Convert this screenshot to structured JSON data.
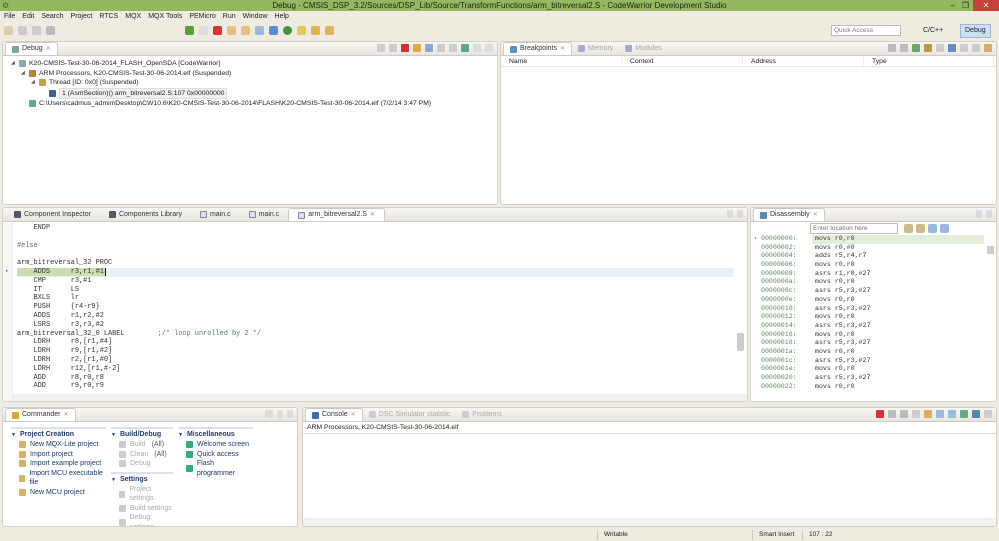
{
  "window": {
    "title": "Debug - CMSIS_DSP_3.2/Sources/DSP_Lib/Source/TransformFunctions/arm_bitreversal2.S - CodeWarrior Development Studio",
    "controls": [
      "–",
      "❐",
      "✕"
    ]
  },
  "menu": [
    "File",
    "Edit",
    "Search",
    "Project",
    "RTCS",
    "MQX",
    "MQX Tools",
    "PEMicro",
    "Run",
    "Window",
    "Help"
  ],
  "toolbar": {
    "quick_access_placeholder": "Quick Access",
    "perspectives": [
      {
        "label": "C/C++",
        "active": false
      },
      {
        "label": "Debug",
        "active": true
      }
    ]
  },
  "debug_view": {
    "tab": "Debug",
    "tree": [
      {
        "level": 0,
        "label": "K20-CMSIS-Test-30-06-2014_FLASH_OpenSDA [CodeWarrior]",
        "icon": "launch-icon"
      },
      {
        "level": 1,
        "label": "ARM Processors, K20-CMSIS-Test-30-06-2014.elf (Suspended)",
        "icon": "processor-icon"
      },
      {
        "level": 2,
        "label": "Thread [ID: 0x0] (Suspended)",
        "icon": "thread-icon"
      },
      {
        "level": 3,
        "label": "1 (AsmSection)() arm_bitreversal2.S:107 0x00000000",
        "icon": "stack-frame-icon",
        "selected": true
      },
      {
        "level": 1,
        "label": "C:\\Users\\cadmus_admin\\Desktop\\CW10.6\\K20-CMSIS-Test-30-06-2014\\FLASH\\K20-CMSIS-Test-30-06-2014.elf (7/2/14 3:47 PM)",
        "icon": "binary-icon"
      }
    ]
  },
  "breakpoints_view": {
    "tabs": [
      {
        "label": "Breakpoints",
        "active": true
      },
      {
        "label": "Memory",
        "active": false
      },
      {
        "label": "Modules",
        "active": false
      }
    ],
    "columns": [
      "Name",
      "Context",
      "Address",
      "Type"
    ]
  },
  "editor": {
    "tabs": [
      {
        "label": "Component Inspector"
      },
      {
        "label": "Components Library"
      },
      {
        "label": "main.c"
      },
      {
        "label": "main.c"
      },
      {
        "label": "arm_bitreversal2.S",
        "active": true
      }
    ],
    "current_line_index": 4,
    "lines": [
      {
        "text": "    ENDP"
      },
      {
        "text": ""
      },
      {
        "text": "#else"
      },
      {
        "text": ""
      },
      {
        "text": "arm_bitreversal_32 PROC"
      },
      {
        "text": "    ADDS     r3,r1,#1"
      },
      {
        "text": "    CMP      r3,#1"
      },
      {
        "text": "    IT       LS"
      },
      {
        "text": "    BXLS     lr"
      },
      {
        "text": "    PUSH     {r4-r9}"
      },
      {
        "text": "    ADDS     r1,r2,#2"
      },
      {
        "text": "    LSRS     r3,r3,#2"
      },
      {
        "text": "arm_bitreversal_32_0 LABEL        ;/* loop unrolled by 2 */"
      },
      {
        "text": "    LDRH     r8,[r1,#4]"
      },
      {
        "text": "    LDRH     r9,[r1,#2]"
      },
      {
        "text": "    LDRH     r2,[r1,#0]"
      },
      {
        "text": "    LDRH     r12,[r1,#-2]"
      },
      {
        "text": "    ADD      r8,r0,r8"
      },
      {
        "text": "    ADD      r9,r0,r9"
      }
    ]
  },
  "disassembly": {
    "tab": "Disassembly",
    "location_placeholder": "Enter location here",
    "rows": [
      {
        "addr": "00000000:",
        "instr": "movs r0,r0"
      },
      {
        "addr": "00000002:",
        "instr": "movs r0,#0"
      },
      {
        "addr": "00000004:",
        "instr": "adds r5,r4,r7"
      },
      {
        "addr": "00000006:",
        "instr": "movs r0,r0"
      },
      {
        "addr": "00000008:",
        "instr": "asrs r1,r0,#27"
      },
      {
        "addr": "0000000a:",
        "instr": "movs r0,r0"
      },
      {
        "addr": "0000000c:",
        "instr": "asrs r5,r3,#27"
      },
      {
        "addr": "0000000e:",
        "instr": "movs r0,r0"
      },
      {
        "addr": "00000010:",
        "instr": "asrs r5,r3,#27"
      },
      {
        "addr": "00000012:",
        "instr": "movs r0,r0"
      },
      {
        "addr": "00000014:",
        "instr": "asrs r5,r3,#27"
      },
      {
        "addr": "00000016:",
        "instr": "movs r0,r0"
      },
      {
        "addr": "00000018:",
        "instr": "asrs r5,r3,#27"
      },
      {
        "addr": "0000001a:",
        "instr": "movs r0,r0"
      },
      {
        "addr": "0000001c:",
        "instr": "asrs r5,r3,#27"
      },
      {
        "addr": "0000001e:",
        "instr": "movs r0,r0"
      },
      {
        "addr": "00000020:",
        "instr": "asrs r5,r3,#27"
      },
      {
        "addr": "00000022:",
        "instr": "movs r0,r0"
      }
    ]
  },
  "commander": {
    "tab": "Commander",
    "sections": [
      {
        "title": "Project Creation",
        "items": [
          {
            "label": "New MQX-Lite project"
          },
          {
            "label": "Import project"
          },
          {
            "label": "Import example project"
          },
          {
            "label": "Import MCU executable file"
          },
          {
            "label": "New MCU project"
          }
        ]
      },
      {
        "title": "Build/Debug",
        "items": [
          {
            "label": "Build",
            "suffix": "(All)",
            "disabled": true
          },
          {
            "label": "Clean",
            "suffix": "(All)",
            "disabled": true
          },
          {
            "label": "Debug",
            "disabled": true
          }
        ]
      },
      {
        "title": "Settings",
        "items": [
          {
            "label": "Project settings",
            "disabled": true
          },
          {
            "label": "Build settings",
            "disabled": true
          },
          {
            "label": "Debug settings",
            "disabled": true
          }
        ]
      },
      {
        "title": "Miscellaneous",
        "items": [
          {
            "label": "Welcome screen"
          },
          {
            "label": "Quick access"
          },
          {
            "label": "Flash programmer"
          }
        ]
      }
    ]
  },
  "console": {
    "tabs": [
      {
        "label": "Console",
        "active": true
      },
      {
        "label": "DSC Simulator statistic",
        "active": false
      },
      {
        "label": "Problems",
        "active": false
      }
    ],
    "text": "ARM Processors, K20-CMSIS-Test-30-06-2014.elf"
  },
  "statusbar": {
    "mode": "Writable",
    "insert": "Smart Insert",
    "position": "107 : 22"
  },
  "colors": {
    "titlebar": "#93b860",
    "current_line": "#c9dfb0",
    "selected_tab": "#ffffff",
    "link": "#1d3a6b"
  }
}
